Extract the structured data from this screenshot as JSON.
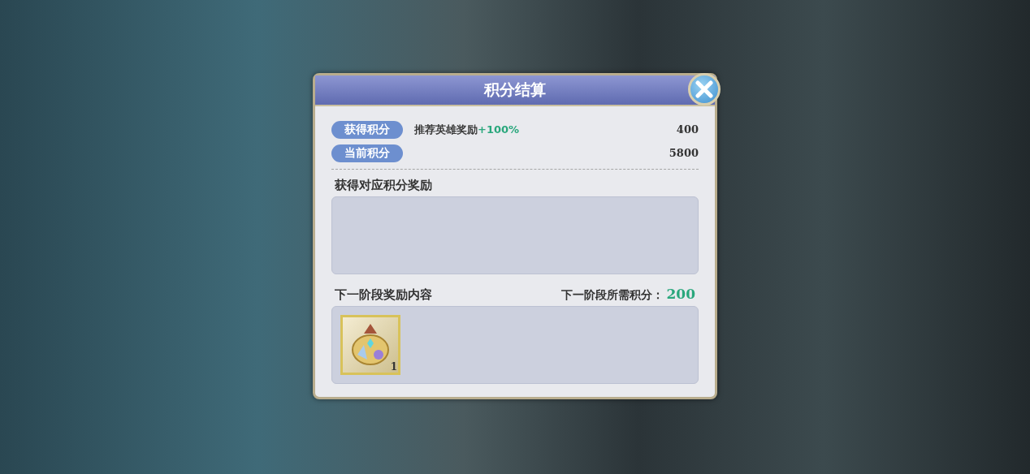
{
  "dialog": {
    "title": "积分结算"
  },
  "score_rows": [
    {
      "tag": "获得积分",
      "note": "推荐英雄奖励",
      "bonus": "+100%",
      "value": "400"
    },
    {
      "tag": "当前积分",
      "value": "5800"
    }
  ],
  "earned_rewards": {
    "heading": "获得对应积分奖励"
  },
  "next_stage": {
    "heading": "下一阶段奖励内容",
    "required_label": "下一阶段所需积分：",
    "required_value": "200",
    "items": [
      {
        "count": "1"
      }
    ]
  }
}
